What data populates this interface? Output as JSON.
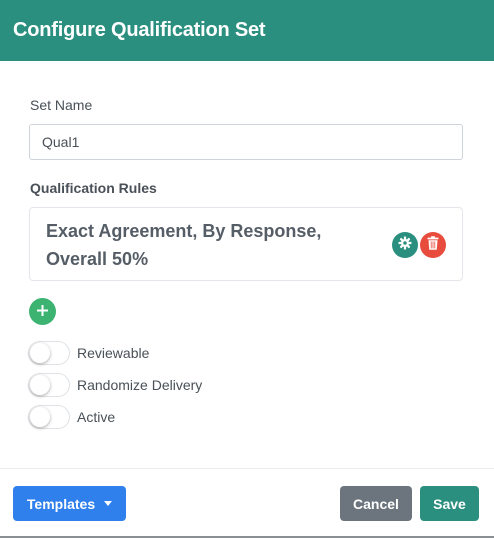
{
  "header": {
    "title": "Configure Qualification Set"
  },
  "form": {
    "set_name_label": "Set Name",
    "set_name_value": "Qual1",
    "rules_label": "Qualification Rules",
    "rules": [
      {
        "text": "Exact Agreement, By Response, Overall 50%",
        "settings_icon": "gear-icon",
        "delete_icon": "trash-icon"
      }
    ],
    "add_icon": "plus-icon",
    "toggles": [
      {
        "label": "Reviewable",
        "on": false
      },
      {
        "label": "Randomize Delivery",
        "on": false
      },
      {
        "label": "Active",
        "on": false
      }
    ]
  },
  "footer": {
    "templates_label": "Templates",
    "cancel_label": "Cancel",
    "save_label": "Save"
  },
  "colors": {
    "header": "#2a8f7f",
    "primary": "#2f80ed",
    "secondary": "#6c757d",
    "success": "#3cb371",
    "danger": "#e74c3c"
  }
}
